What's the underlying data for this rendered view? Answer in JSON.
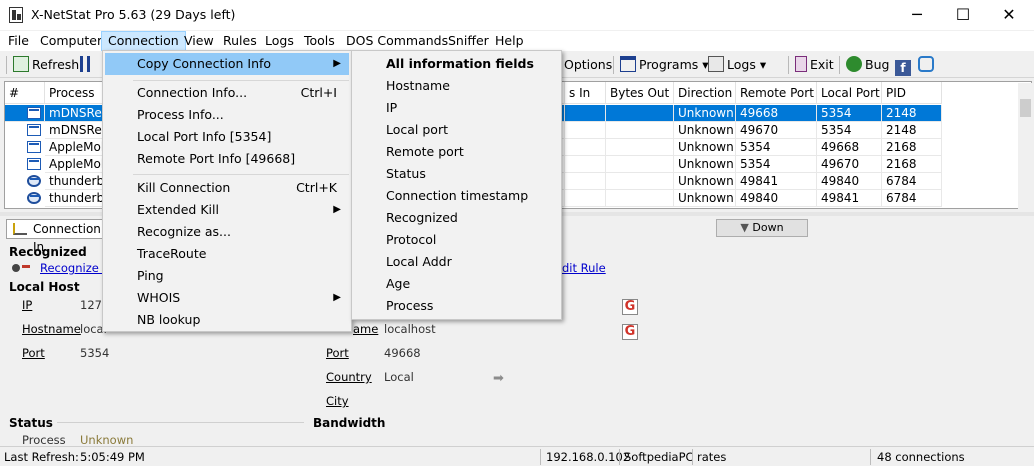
{
  "window": {
    "title": "X-NetStat Pro 5.63 (29 Days left)",
    "minimize": "─",
    "maximize": "☐",
    "close": "✕"
  },
  "menubar": [
    "File",
    "Computer",
    "Connection",
    "View",
    "Rules",
    "Logs",
    "Tools",
    "DOS Commands",
    "Sniffer",
    "Help"
  ],
  "toolbar": {
    "refresh": "Refresh",
    "options": "Options",
    "programs": "Programs",
    "logs": "Logs",
    "exit": "Exit",
    "bug": "Bug"
  },
  "table": {
    "headers": [
      "#",
      "Process",
      "s In",
      "Bytes Out",
      "Direction",
      "Remote Port",
      "Local Port",
      "PID"
    ],
    "rows": [
      {
        "process": "mDNSResp",
        "direction": "Unknown",
        "remote_port": "49668",
        "local_port": "5354",
        "pid": "2148"
      },
      {
        "process": "mDNSResp",
        "direction": "Unknown",
        "remote_port": "49670",
        "local_port": "5354",
        "pid": "2148"
      },
      {
        "process": "AppleMobi",
        "direction": "Unknown",
        "remote_port": "5354",
        "local_port": "49668",
        "pid": "2168"
      },
      {
        "process": "AppleMobi",
        "direction": "Unknown",
        "remote_port": "5354",
        "local_port": "49670",
        "pid": "2168"
      },
      {
        "process": "thunderbir",
        "direction": "Unknown",
        "remote_port": "49841",
        "local_port": "49840",
        "pid": "6784"
      },
      {
        "process": "thunderbir",
        "direction": "Unknown",
        "remote_port": "49840",
        "local_port": "49841",
        "pid": "6784"
      }
    ]
  },
  "details": {
    "tab": "Connection In",
    "down_button": "Down",
    "recognized_header": "Recognized",
    "recognize_link": "Recognize th",
    "edit_rule_link": "dit Rule",
    "local_host_header": "Local Host",
    "ip_label": "IP",
    "ip_value": "127.",
    "hostname_label": "Hostname",
    "hostname_value": "local",
    "port_label": "Port",
    "port_value": "5354",
    "remote_hostname_label": "ame",
    "remote_hostname_value": "localhost",
    "remote_port_label": "Port",
    "remote_port_value": "49668",
    "country_label": "Country",
    "country_value": "Local",
    "city_label": "City",
    "status_header": "Status",
    "bandwidth_header": "Bandwidth",
    "process_label": "Process",
    "process_value": "Unknown",
    "g_icon": "G"
  },
  "statusbar": {
    "last_refresh_label": "Last Refresh:",
    "last_refresh_time": "5:05:49 PM",
    "ip": "192.168.0.102",
    "host": "SoftpediaPC",
    "rates": "rates",
    "connections": "48 connections"
  },
  "connection_menu": [
    {
      "label": "Copy Connection Info",
      "shortcut": "",
      "submenu": true
    },
    {
      "label": "Connection Info...",
      "shortcut": "Ctrl+I",
      "submenu": false
    },
    {
      "label": "Process Info...",
      "shortcut": "",
      "submenu": false
    },
    {
      "label": "Local Port Info [5354]",
      "shortcut": "",
      "submenu": false
    },
    {
      "label": "Remote Port Info [49668]",
      "shortcut": "",
      "submenu": false
    },
    {
      "label": "Kill Connection",
      "shortcut": "Ctrl+K",
      "submenu": false
    },
    {
      "label": "Extended Kill",
      "shortcut": "",
      "submenu": true
    },
    {
      "label": "Recognize as...",
      "shortcut": "",
      "submenu": false
    },
    {
      "label": "TraceRoute",
      "shortcut": "",
      "submenu": false
    },
    {
      "label": "Ping",
      "shortcut": "",
      "submenu": false
    },
    {
      "label": "WHOIS",
      "shortcut": "",
      "submenu": true
    },
    {
      "label": "NB lookup",
      "shortcut": "",
      "submenu": false
    }
  ],
  "copy_submenu": [
    "All information fields",
    "Hostname",
    "IP",
    "Local port",
    "Remote port",
    "Status",
    "Connection timestamp",
    "Recognized",
    "Protocol",
    "Local Addr",
    "Age",
    "Process"
  ],
  "colors": {
    "selection": "#0078d7",
    "menu_highlight": "#91c9f7",
    "unknown_text": "#8a7a3a"
  }
}
